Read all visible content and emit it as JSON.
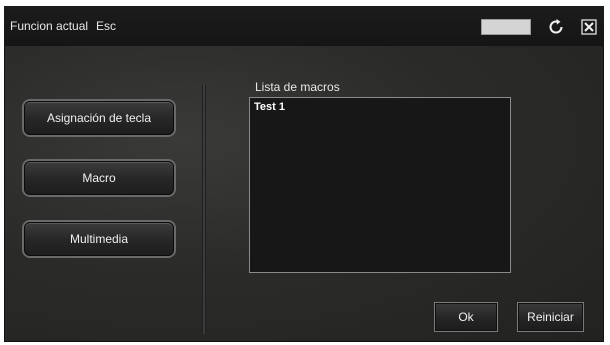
{
  "titlebar": {
    "label": "Funcion actual",
    "current_function": "Esc",
    "field_value": ""
  },
  "sidebar": {
    "items": [
      {
        "label": "Asignación de tecla"
      },
      {
        "label": "Macro"
      },
      {
        "label": "Multimedia"
      }
    ]
  },
  "main": {
    "list_label": "Lista de macros",
    "macros": [
      {
        "name": "Test 1"
      }
    ]
  },
  "actions": {
    "ok_label": "Ok",
    "reset_label": "Reiniciar"
  },
  "icons": {
    "refresh": "refresh-icon",
    "close": "close-icon"
  },
  "colors": {
    "background": "#2b2b29",
    "titlebar": "#151515",
    "text": "#f0f0f0",
    "list_background": "#171717"
  }
}
